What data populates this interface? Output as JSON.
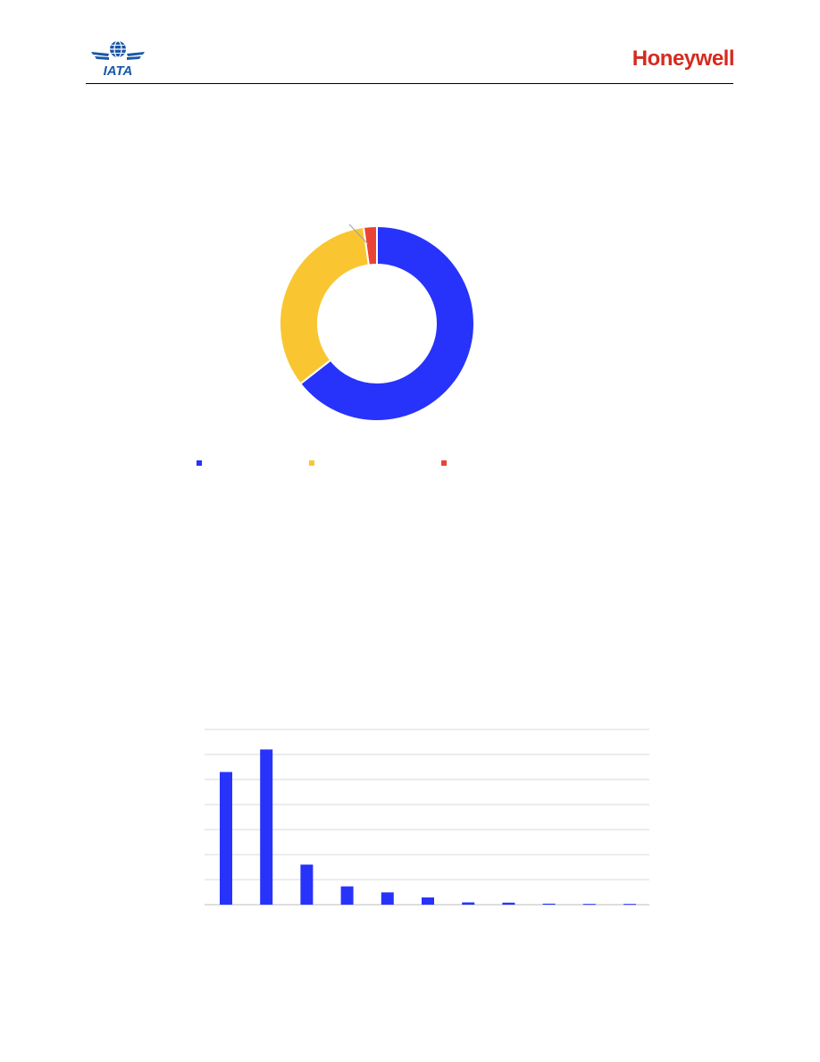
{
  "header": {
    "iata_logo_text": "IATA",
    "honeywell_logo_text": "Honeywell"
  },
  "colors": {
    "blue": "#2733fb",
    "yellow": "#f9c632",
    "red": "#ea4335",
    "gridline": "#d9d9d9",
    "iata_blue": "#1a57a8",
    "honeywell_red": "#d52b1e"
  },
  "chart_data": [
    {
      "type": "pie",
      "style": "donut",
      "values": [
        64.4,
        33.4,
        2.2
      ],
      "colors": [
        "#2733fb",
        "#f9c632",
        "#ea4335"
      ],
      "legend_placement": "bottom"
    },
    {
      "type": "bar",
      "categories_count": 11,
      "values": [
        5.3,
        6.2,
        1.6,
        0.73,
        0.49,
        0.29,
        0.09,
        0.08,
        0.04,
        0.03,
        0.03
      ],
      "ylim": [
        0,
        7
      ],
      "grid": true,
      "color": "#2733fb"
    }
  ]
}
